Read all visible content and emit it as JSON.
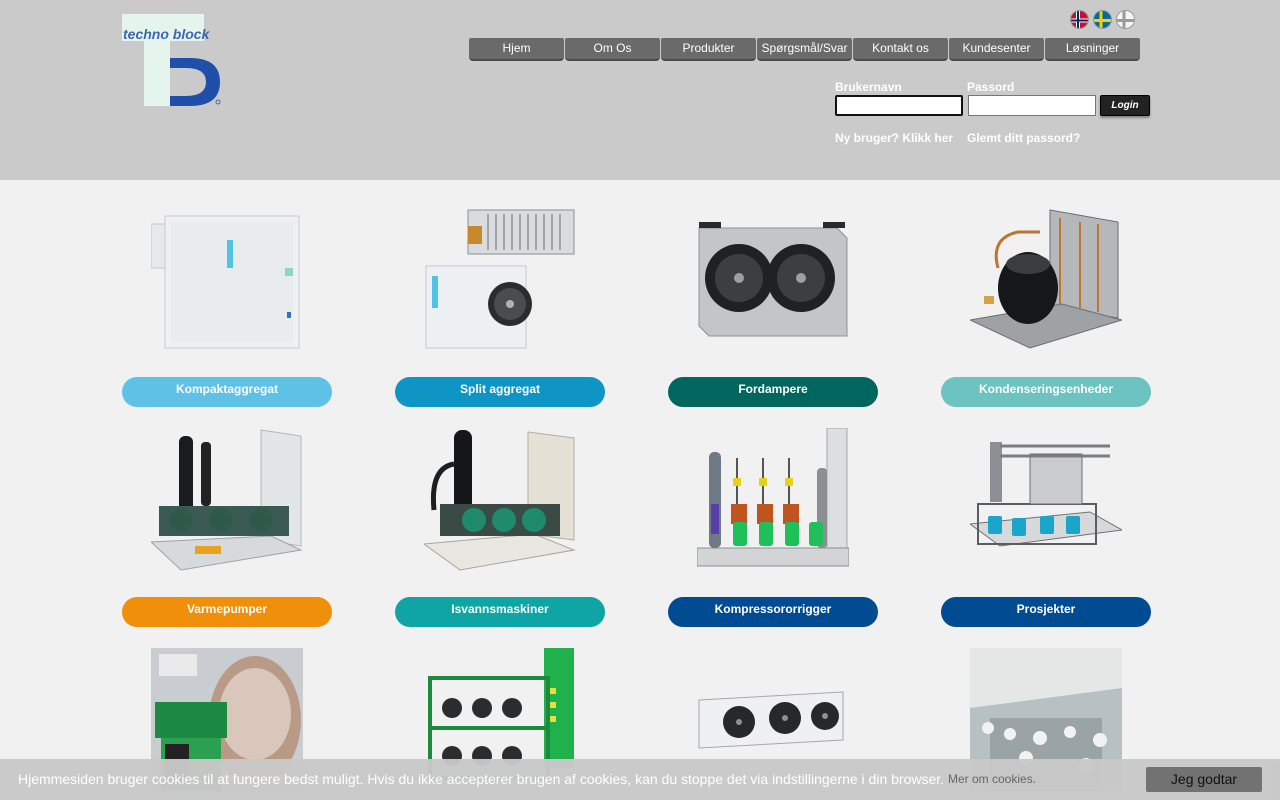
{
  "logo": {
    "text_top": "techno block",
    "letters": "TB"
  },
  "languages": [
    {
      "name": "norwegian-flag"
    },
    {
      "name": "swedish-flag"
    },
    {
      "name": "danish-flag"
    }
  ],
  "nav": {
    "items": [
      "Hjem",
      "Om Os",
      "Produkter",
      "Spørgsmål/Svar",
      "Kontakt os",
      "Kundesenter",
      "Løsninger"
    ]
  },
  "login": {
    "username_label": "Brukernavn",
    "username_value": "",
    "password_label": "Passord",
    "password_value": "",
    "button_label": "Login",
    "register_link": "Ny bruger? Klikk her",
    "forgot_link": "Glemt ditt passord?"
  },
  "products": [
    {
      "label": "Kompaktaggregat",
      "color": "#5ec2e7"
    },
    {
      "label": "Split aggregat",
      "color": "#0e95c4"
    },
    {
      "label": "Fordampere",
      "color": "#00665e"
    },
    {
      "label": "Kondenseringsenheder",
      "color": "#6cc3bf"
    },
    {
      "label": "Varmepumper",
      "color": "#f0900a"
    },
    {
      "label": "Isvannsmaskiner",
      "color": "#0fa5a5"
    },
    {
      "label": "Kompressororrigger",
      "color": "#004b91"
    },
    {
      "label": "Prosjekter",
      "color": "#004b91"
    },
    {
      "label": "",
      "color": ""
    },
    {
      "label": "",
      "color": ""
    },
    {
      "label": "",
      "color": ""
    },
    {
      "label": "",
      "color": ""
    }
  ],
  "cookie": {
    "message": "Hjemmesiden bruger cookies til at fungere bedst muligt. Hvis du ikke accepterer brugen af cookies, kan du stoppe det via indstillingerne i din browser.",
    "more_link": "Mer om cookies.",
    "accept_label": "Jeg godtar"
  },
  "colors": {
    "header_bg": "#cacaca",
    "page_bg": "#f1f1f1",
    "nav_bg": "#6a6a6a",
    "logo_blue": "#1f4fa8",
    "logo_mint": "#e6f4ee"
  }
}
